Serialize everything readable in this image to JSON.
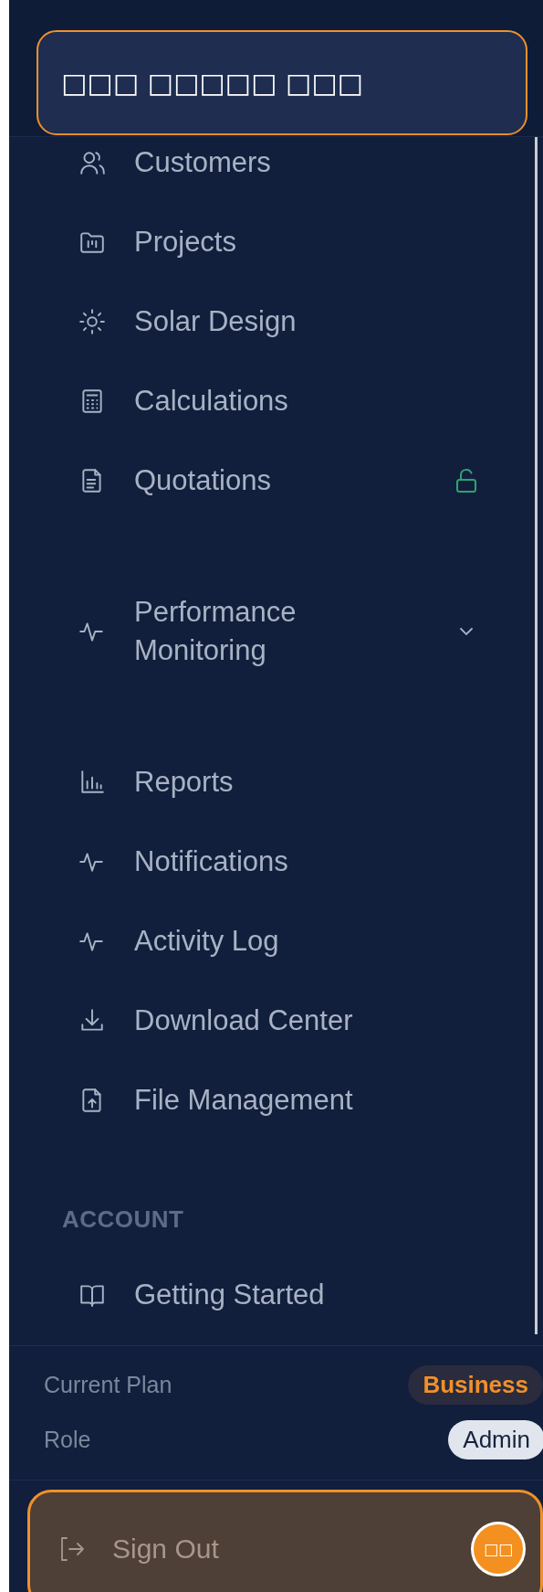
{
  "header": {
    "title": "□□□ □□□□□ □□□"
  },
  "nav_items": [
    {
      "label": "Customers",
      "kind": "link",
      "unlocked": false
    },
    {
      "label": "Projects",
      "kind": "link",
      "unlocked": false
    },
    {
      "label": "Solar Design",
      "kind": "link",
      "unlocked": false
    },
    {
      "label": "Calculations",
      "kind": "link",
      "unlocked": false
    },
    {
      "label": "Quotations",
      "kind": "link",
      "unlocked": true
    },
    {
      "label": "Performance Monitoring",
      "kind": "group",
      "expanded": false,
      "unlocked": false
    },
    {
      "label": "Reports",
      "kind": "link",
      "unlocked": false
    },
    {
      "label": "Notifications",
      "kind": "link",
      "unlocked": false
    },
    {
      "label": "Activity Log",
      "kind": "link",
      "unlocked": false
    },
    {
      "label": "Download Center",
      "kind": "link",
      "unlocked": false
    },
    {
      "label": "File Management",
      "kind": "link",
      "unlocked": false
    }
  ],
  "account_section": {
    "heading": "ACCOUNT",
    "items": [
      {
        "label": "Getting Started"
      }
    ]
  },
  "plan_info": [
    {
      "label": "Current Plan",
      "value": "Business",
      "kind": "plan"
    },
    {
      "label": "Role",
      "value": "Admin",
      "kind": "role"
    }
  ],
  "sign_out": {
    "label": "Sign Out",
    "badge": "□□"
  }
}
